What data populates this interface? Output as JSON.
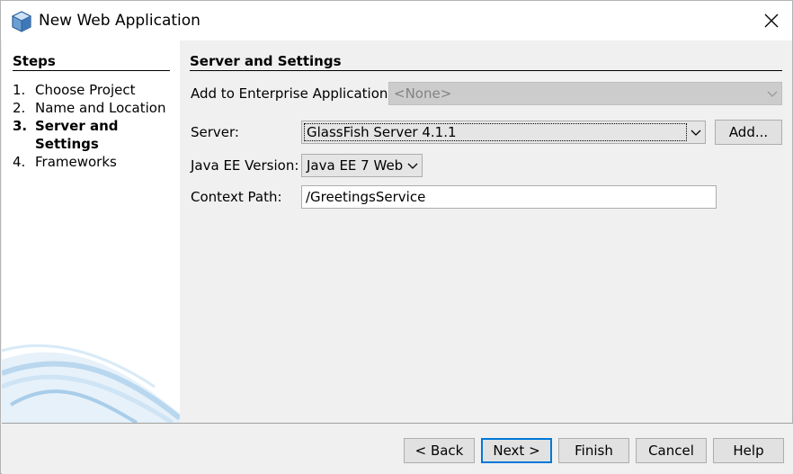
{
  "window": {
    "title": "New Web Application",
    "icon": "netbeans-cube-icon"
  },
  "steps": {
    "heading": "Steps",
    "items": [
      {
        "num": "1.",
        "label": "Choose Project",
        "current": false
      },
      {
        "num": "2.",
        "label": "Name and Location",
        "current": false
      },
      {
        "num": "3.",
        "label": "Server and Settings",
        "current": true
      },
      {
        "num": "4.",
        "label": "Frameworks",
        "current": false
      }
    ]
  },
  "main": {
    "heading": "Server and Settings",
    "enterprise_label": "Add to Enterprise Application:",
    "enterprise_value": "<None>",
    "server_label": "Server:",
    "server_value": "GlassFish Server 4.1.1",
    "add_button": "Add...",
    "javaee_label": "Java EE Version:",
    "javaee_value": "Java EE 7 Web",
    "context_label": "Context Path:",
    "context_value": "/GreetingsService"
  },
  "buttons": {
    "back": "< Back",
    "next": "Next >",
    "finish": "Finish",
    "cancel": "Cancel",
    "help": "Help"
  },
  "colors": {
    "accent": "#0078d7",
    "panel_bg": "#f0f0f0",
    "swoosh": "#b9d7ee"
  }
}
